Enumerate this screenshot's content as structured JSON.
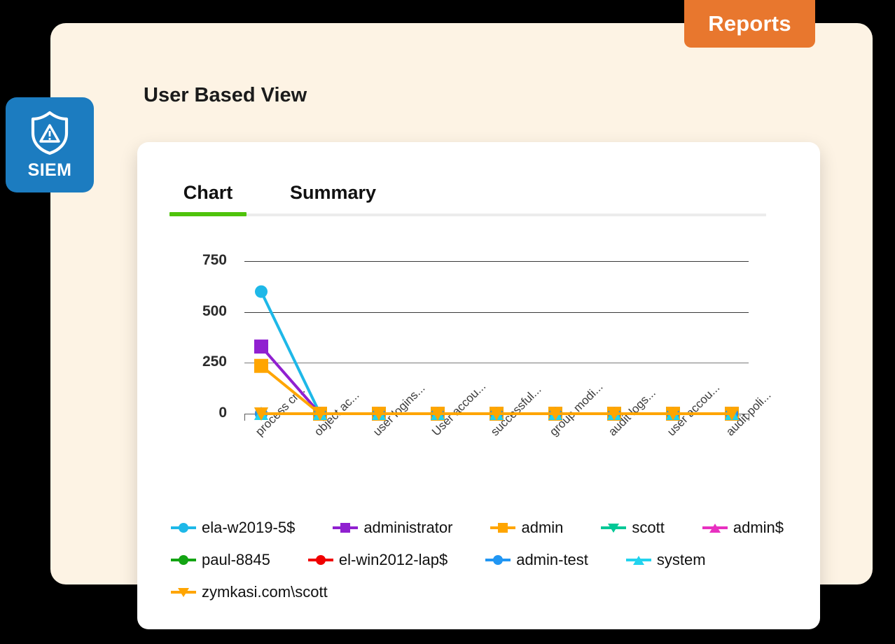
{
  "reports_tab": {
    "label": "Reports",
    "color": "#E8772E"
  },
  "badge": {
    "label": "SIEM",
    "icon": "shield-warning-icon",
    "color": "#1C7CC0"
  },
  "header": {
    "title": "User Based View"
  },
  "tabs": [
    {
      "label": "Chart",
      "active": true,
      "accent": "#4FC30B"
    },
    {
      "label": "Summary",
      "active": false
    }
  ],
  "chart_data": {
    "type": "line",
    "title": "",
    "xlabel": "",
    "ylabel": "",
    "ylim": [
      0,
      800
    ],
    "yticks": [
      0,
      250,
      500,
      750
    ],
    "grid": true,
    "legend_position": "bottom",
    "categories": [
      "process cr...",
      "object ac...",
      "user logins...",
      "User accou...",
      "successful...",
      "group modi...",
      "audit logs...",
      "user accou...",
      "audit poli..."
    ],
    "series": [
      {
        "name": "ela-w2019-5$",
        "color": "#1EB8E8",
        "marker": "circle",
        "values": [
          600,
          0,
          0,
          0,
          0,
          0,
          0,
          0,
          0
        ]
      },
      {
        "name": "administrator",
        "color": "#9020D0",
        "marker": "square",
        "values": [
          330,
          0,
          0,
          0,
          0,
          0,
          0,
          0,
          0
        ]
      },
      {
        "name": "admin",
        "color": "#FFA500",
        "marker": "square",
        "values": [
          235,
          0,
          0,
          0,
          0,
          0,
          0,
          0,
          0
        ]
      },
      {
        "name": "scott",
        "color": "#00C896",
        "marker": "tri-down",
        "values": [
          0,
          0,
          0,
          0,
          0,
          0,
          0,
          0,
          0
        ]
      },
      {
        "name": "admin$",
        "color": "#E830C0",
        "marker": "tri-up",
        "values": [
          0,
          0,
          0,
          0,
          0,
          0,
          0,
          0,
          0
        ]
      },
      {
        "name": "paul-8845",
        "color": "#13A413",
        "marker": "circle",
        "values": [
          0,
          0,
          0,
          0,
          0,
          0,
          0,
          0,
          0
        ]
      },
      {
        "name": "el-win2012-lap$",
        "color": "#F00000",
        "marker": "circle",
        "values": [
          0,
          0,
          0,
          0,
          0,
          0,
          0,
          0,
          0
        ]
      },
      {
        "name": "admin-test",
        "color": "#2196F3",
        "marker": "circle",
        "values": [
          0,
          0,
          0,
          0,
          0,
          0,
          0,
          0,
          0
        ]
      },
      {
        "name": "system",
        "color": "#22D3EE",
        "marker": "tri-up",
        "values": [
          0,
          0,
          0,
          0,
          0,
          0,
          0,
          0,
          0
        ]
      },
      {
        "name": "zymkasi.com\\scott",
        "color": "#FFA500",
        "marker": "tri-down",
        "values": [
          0,
          0,
          0,
          0,
          0,
          0,
          0,
          0,
          0
        ]
      }
    ]
  }
}
